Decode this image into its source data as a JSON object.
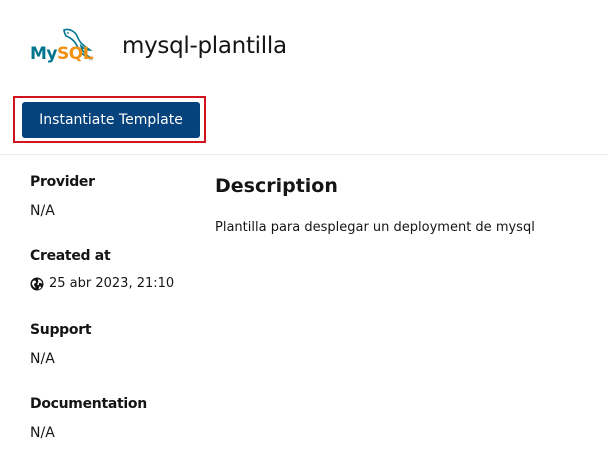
{
  "header": {
    "logo_my": "My",
    "logo_sql": "SQL",
    "logo_tm": "™",
    "title": "mysql-plantilla",
    "instantiate_label": "Instantiate Template"
  },
  "details": {
    "provider_label": "Provider",
    "provider_value": "N/A",
    "created_label": "Created at",
    "created_icon": "globe-icon",
    "created_value": "25 abr 2023, 21:10",
    "support_label": "Support",
    "support_value": "N/A",
    "documentation_label": "Documentation",
    "documentation_value": "N/A"
  },
  "description": {
    "title": "Description",
    "text": "Plantilla para desplegar un deployment de mysql"
  },
  "colors": {
    "primary_button": "#06427c",
    "highlight": "#d2141e",
    "mysql_blue": "#00758f",
    "mysql_orange": "#f29111"
  }
}
